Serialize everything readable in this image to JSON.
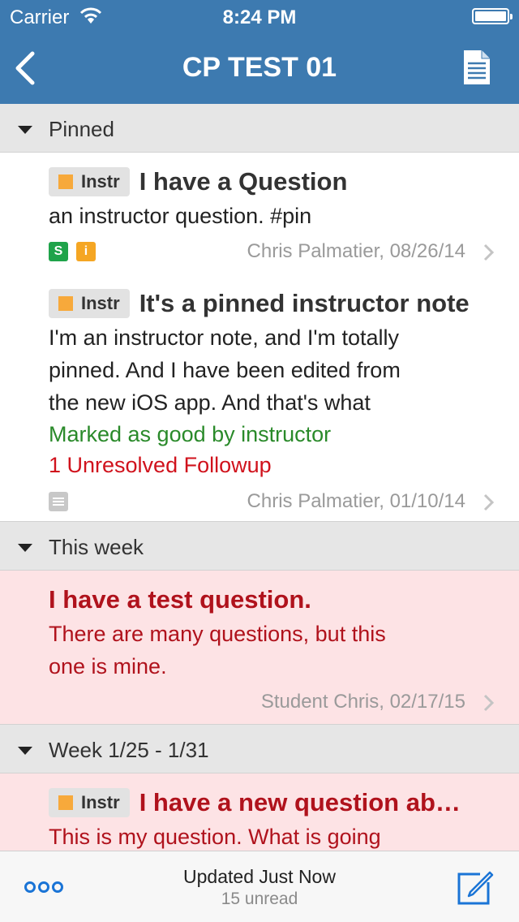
{
  "status_bar": {
    "carrier": "Carrier",
    "time": "8:24 PM"
  },
  "nav": {
    "title": "CP TEST 01"
  },
  "sections": {
    "pinned": {
      "label": "Pinned"
    },
    "this_week": {
      "label": "This week"
    },
    "week_range": {
      "label": "Week 1/25 - 1/31"
    }
  },
  "posts": {
    "p1": {
      "badge": "Instr",
      "title": "I have a Question",
      "body": "an instructor question. #pin",
      "tags": [
        "S",
        "i"
      ],
      "author": "Chris Palmatier, 08/26/14"
    },
    "p2": {
      "badge": "Instr",
      "title": "It's a pinned instructor note",
      "body_lines": [
        "I'm an instructor note, and I'm totally",
        "pinned. And I have been edited from",
        "the new iOS app. And that's what"
      ],
      "good_note": "Marked as good by instructor",
      "followup": "1 Unresolved Followup",
      "author": "Chris Palmatier, 01/10/14"
    },
    "p3": {
      "title": "I have a test question.",
      "body_lines": [
        "There are many questions, but this",
        "one is mine."
      ],
      "author": "Student Chris, 02/17/15"
    },
    "p4": {
      "badge": "Instr",
      "title": "I have a new question ab…",
      "body": "This is my question. What is going"
    }
  },
  "toolbar": {
    "updated": "Updated Just Now",
    "unread": "15 unread"
  },
  "colors": {
    "nav_bg": "#3d7ab0",
    "unread_bg": "#fde3e5",
    "unread_text": "#b0121c",
    "good_text": "#2a8a2a",
    "followup_text": "#d0121c",
    "instr_square": "#f7a93b",
    "tint": "#1a74d6"
  },
  "icons": {
    "back": "chevron-left-icon",
    "doc": "document-icon",
    "more": "more-dots-icon",
    "compose": "compose-icon"
  }
}
